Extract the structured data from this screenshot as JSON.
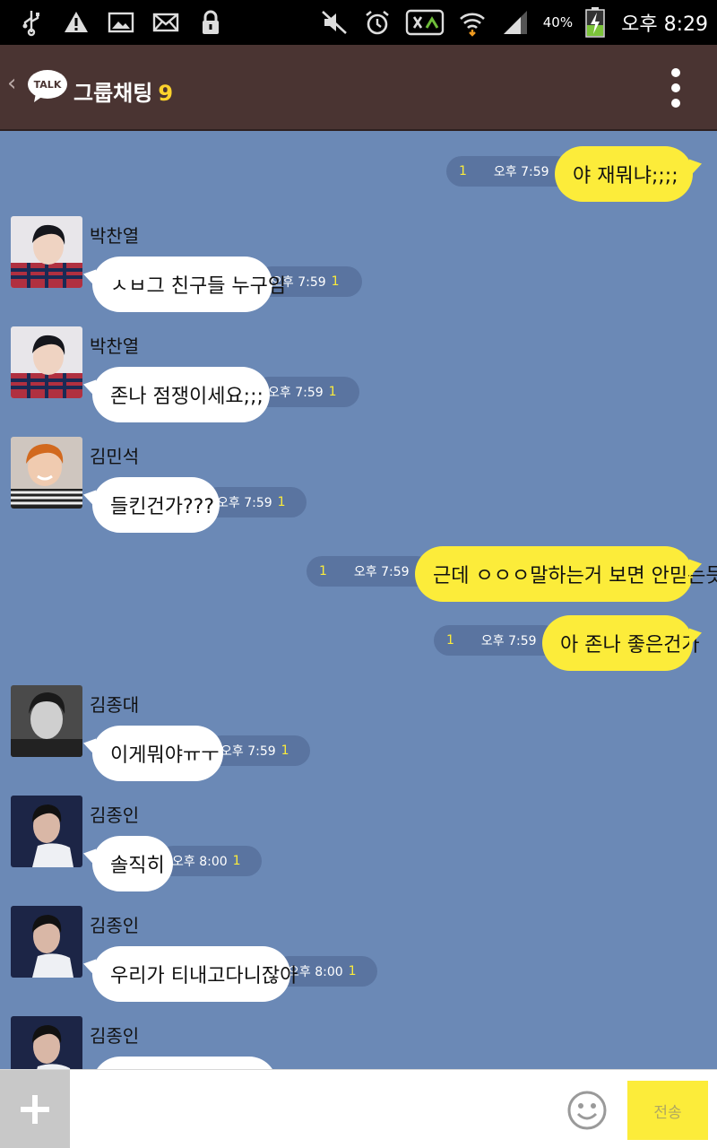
{
  "statusbar": {
    "left_icons": [
      "usb-icon",
      "warning-icon",
      "image-icon",
      "mail-icon",
      "lock-icon"
    ],
    "right_icons": [
      "mute-icon",
      "alarm-icon",
      "app-icon",
      "wifi-icon",
      "signal-icon",
      "battery-icon"
    ],
    "battery": "40%",
    "clock": "오후 8:29"
  },
  "header": {
    "logo_text": "TALK",
    "title": "그룹채팅",
    "count": "9"
  },
  "messages": [
    {
      "kind": "out",
      "text": "야 재뭐냐;;;;",
      "time": "오후 7:59",
      "unread": "1"
    },
    {
      "kind": "in",
      "sender": "박찬열",
      "text": "ㅅㅂ그 친구들 누구임",
      "time": "오후 7:59",
      "unread": "1"
    },
    {
      "kind": "in",
      "sender": "박찬열",
      "text": "존나 점쟁이세요;;;",
      "time": "오후 7:59",
      "unread": "1"
    },
    {
      "kind": "in",
      "sender": "김민석",
      "text": "들킨건가???",
      "time": "오후 7:59",
      "unread": "1"
    },
    {
      "kind": "out",
      "text": "근데 ㅇㅇㅇ말하는거 보면 안믿는듯",
      "time": "오후 7:59",
      "unread": "1"
    },
    {
      "kind": "out",
      "text": "아 존나 좋은건가",
      "time": "오후 7:59",
      "unread": "1"
    },
    {
      "kind": "in",
      "sender": "김종대",
      "text": "이게뭐야ㅠㅜ",
      "time": "오후 7:59",
      "unread": "1"
    },
    {
      "kind": "in",
      "sender": "김종인",
      "text": "솔직히",
      "time": "오후 8:00",
      "unread": "1"
    },
    {
      "kind": "in",
      "sender": "김종인",
      "text": "우리가 티내고다니잖아",
      "time": "오후 8:00",
      "unread": "1"
    },
    {
      "kind": "in",
      "sender": "김종인",
      "text": "",
      "time": "",
      "unread": ""
    }
  ],
  "inputbar": {
    "placeholder": "",
    "send_label": "전송"
  },
  "colors": {
    "chat_bg": "#6b89b6",
    "header_bg": "#4a3432",
    "bubble_out": "#fcec3a",
    "bubble_in": "#ffffff",
    "accent": "#fcd22c"
  }
}
